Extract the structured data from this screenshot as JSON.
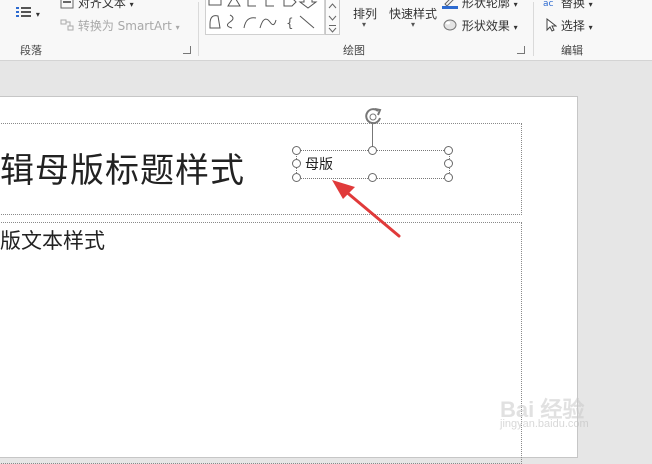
{
  "ribbon": {
    "paragraph": {
      "label": "段落",
      "align_text": "对齐文本",
      "convert_smartart": "转换为 SmartArt"
    },
    "drawing": {
      "label": "绘图",
      "arrange": "排列",
      "quick_styles": "快速样式",
      "shape_outline": "形状轮廓",
      "shape_effects": "形状效果"
    },
    "editing": {
      "label": "编辑",
      "replace": "替换",
      "select": "选择"
    }
  },
  "slide": {
    "title_placeholder": "辑母版标题样式",
    "body_placeholder": "版文本样式",
    "selected_textbox_text": "母版"
  },
  "watermark": {
    "main": "Bai 经验",
    "sub": "jingyan.baidu.com"
  },
  "colors": {
    "arrow": "#e03a3a",
    "shape_outline_bar": "#2e6bd0"
  }
}
